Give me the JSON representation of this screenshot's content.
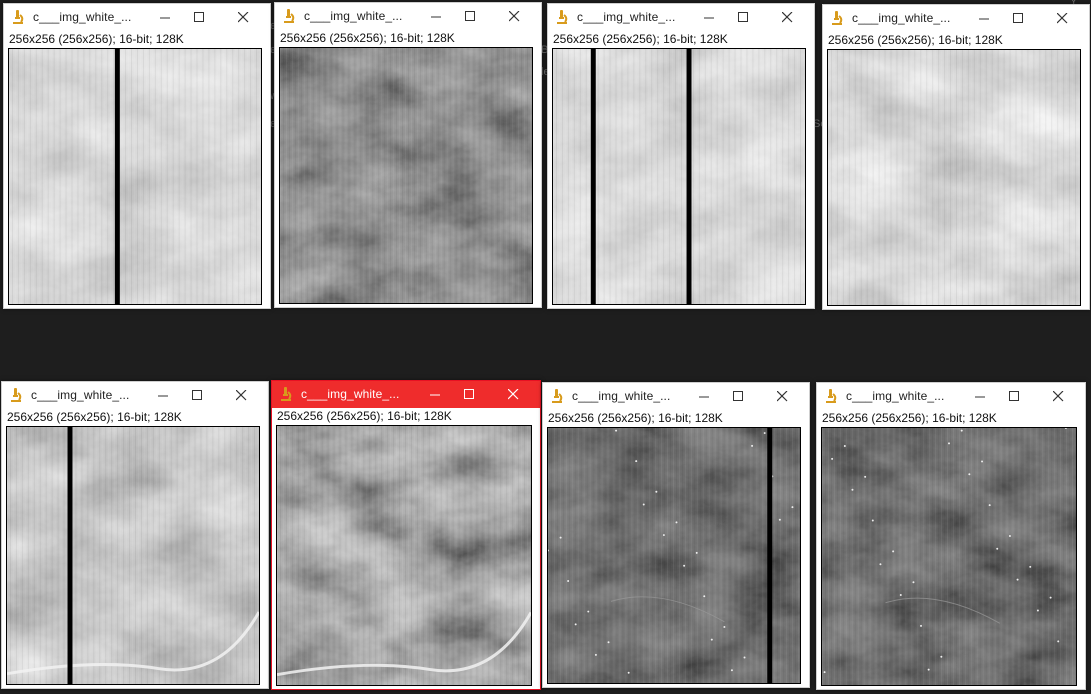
{
  "background": {
    "color": "#1e1e1e",
    "fragments": [
      "e",
      "e",
      "le",
      "w",
      "Se",
      "B",
      "e",
      "Y"
    ]
  },
  "windows": [
    {
      "title": "c___img_white_...",
      "info": "256x256   (256x256); 16-bit; 128K",
      "active": false,
      "tone": "light",
      "stripes": 1
    },
    {
      "title": "c___img_white_...",
      "info": "256x256   (256x256); 16-bit; 128K",
      "active": false,
      "tone": "dark",
      "stripes": 0
    },
    {
      "title": "c___img_white_...",
      "info": "256x256   (256x256); 16-bit; 128K",
      "active": false,
      "tone": "light",
      "stripes": 2
    },
    {
      "title": "c___img_white_...",
      "info": "256x256   (256x256); 16-bit; 128K",
      "active": false,
      "tone": "light",
      "stripes": 0
    },
    {
      "title": "c___img_white_...",
      "info": "256x256   (256x256); 16-bit; 128K",
      "active": false,
      "tone": "mid",
      "stripes": 1
    },
    {
      "title": "c___img_white_...",
      "info": "256x256   (256x256); 16-bit; 128K",
      "active": true,
      "tone": "darkmid",
      "stripes": 0
    },
    {
      "title": "c___img_white_...",
      "info": "256x256   (256x256); 16-bit; 128K",
      "active": false,
      "tone": "verydark",
      "stripes": 1
    },
    {
      "title": "c___img_white_...",
      "info": "256x256   (256x256); 16-bit; 128K",
      "active": false,
      "tone": "verydark",
      "stripes": 0
    }
  ],
  "colors": {
    "active_title_bar": "#ef2c2c",
    "app_icon": "#d89b1c"
  },
  "icons": {
    "app": "microscope-icon",
    "minimize": "minimize-icon",
    "maximize": "maximize-icon",
    "close": "close-icon"
  }
}
